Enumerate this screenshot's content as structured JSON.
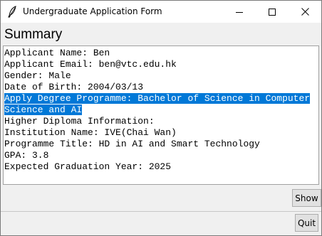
{
  "window": {
    "title": "Undergraduate Application Form",
    "app_icon": "feather-icon",
    "controls": [
      "minimize-icon",
      "maximize-icon",
      "close-icon"
    ]
  },
  "heading": "Summary",
  "summary": {
    "lines": [
      {
        "text": "Applicant Name: Ben",
        "selected": false
      },
      {
        "text": "Applicant Email: ben@vtc.edu.hk",
        "selected": false
      },
      {
        "text": "Gender: Male",
        "selected": false
      },
      {
        "text": "Date of Birth: 2004/03/13",
        "selected": false
      },
      {
        "text": "Apply Degree Programme: Bachelor of Science in Computer",
        "selected": true
      },
      {
        "text": "Science and AI",
        "selected": true
      },
      {
        "text": "Higher Diploma Information:",
        "selected": false
      },
      {
        "text": "Institution Name: IVE(Chai Wan)",
        "selected": false
      },
      {
        "text": "Programme Title: HD in AI and Smart Technology",
        "selected": false
      },
      {
        "text": "GPA: 3.8",
        "selected": false
      },
      {
        "text": "Expected Graduation Year: 2025",
        "selected": false
      }
    ],
    "selection_color": "#0078d7"
  },
  "buttons": {
    "show": "Show",
    "quit": "Quit"
  }
}
